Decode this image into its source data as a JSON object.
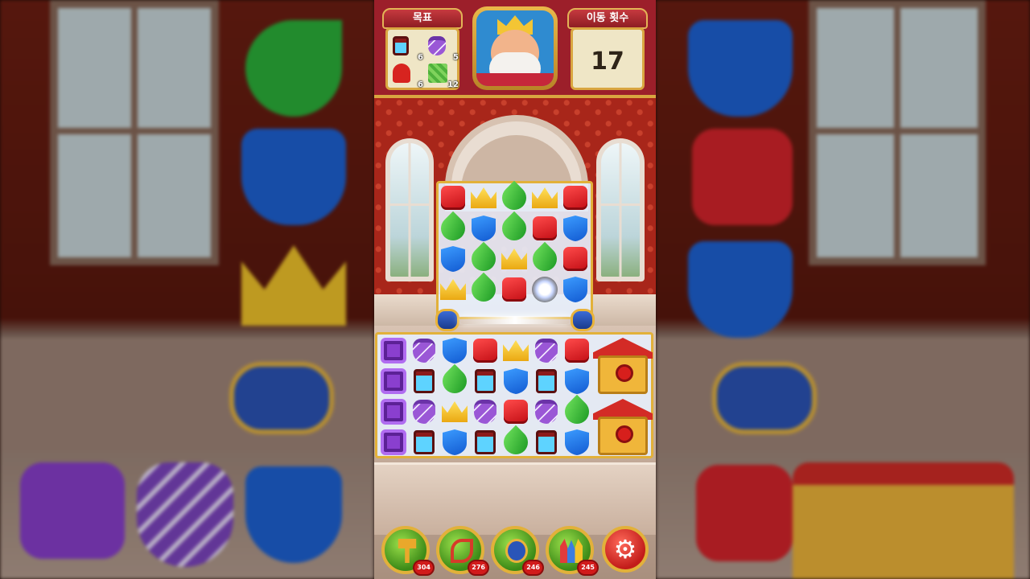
{
  "header": {
    "goals_label": "목표",
    "moves_label": "이동 횟수",
    "moves_left": "17",
    "goals": [
      {
        "icon": "lantern-icon",
        "count": "6"
      },
      {
        "icon": "purple-vase-icon",
        "count": "5"
      },
      {
        "icon": "doghouse-figure-icon",
        "count": "6"
      },
      {
        "icon": "grass-tile-icon",
        "count": "12"
      }
    ]
  },
  "boosters": [
    {
      "icon": "hammer-icon",
      "count": "304"
    },
    {
      "icon": "bow-arrow-icon",
      "count": "276"
    },
    {
      "icon": "cannon-icon",
      "count": "246"
    },
    {
      "icon": "jester-hat-icon",
      "count": "245"
    }
  ],
  "settings": {
    "icon": "gear-icon",
    "glyph": "⚙"
  },
  "colors": {
    "header_bg": "#9c1f2a",
    "gold_border": "#e2b13a",
    "red_block": "#e0222a",
    "blue_shield": "#1f6fe0",
    "green_leaf": "#2fb236",
    "yellow_crown": "#f5c22a",
    "purple": "#9a57d6"
  },
  "board": {
    "upper_rows": [
      [
        "red-block",
        "yellow-crown",
        "green-leaf",
        "yellow-crown",
        "red-block"
      ],
      [
        "green-leaf",
        "blue-shield",
        "green-leaf",
        "red-block",
        "blue-shield"
      ],
      [
        "blue-shield",
        "green-leaf",
        "yellow-crown",
        "green-leaf",
        "red-block"
      ],
      [
        "yellow-crown",
        "green-leaf",
        "red-block",
        "explosion",
        "blue-shield"
      ]
    ],
    "lower_rows": [
      [
        "purple-box",
        "purple-vase",
        "blue-shield",
        "red-block",
        "yellow-crown",
        "purple-vase",
        "red-block"
      ],
      [
        "purple-box",
        "lantern",
        "green-leaf",
        "lantern",
        "blue-shield",
        "lantern",
        "blue-shield"
      ],
      [
        "purple-box",
        "purple-vase",
        "yellow-crown",
        "purple-vase",
        "red-block",
        "purple-vase",
        "green-leaf"
      ],
      [
        "purple-box",
        "lantern",
        "blue-shield",
        "lantern",
        "green-leaf",
        "lantern",
        "blue-shield"
      ]
    ],
    "doghouses": 2
  }
}
